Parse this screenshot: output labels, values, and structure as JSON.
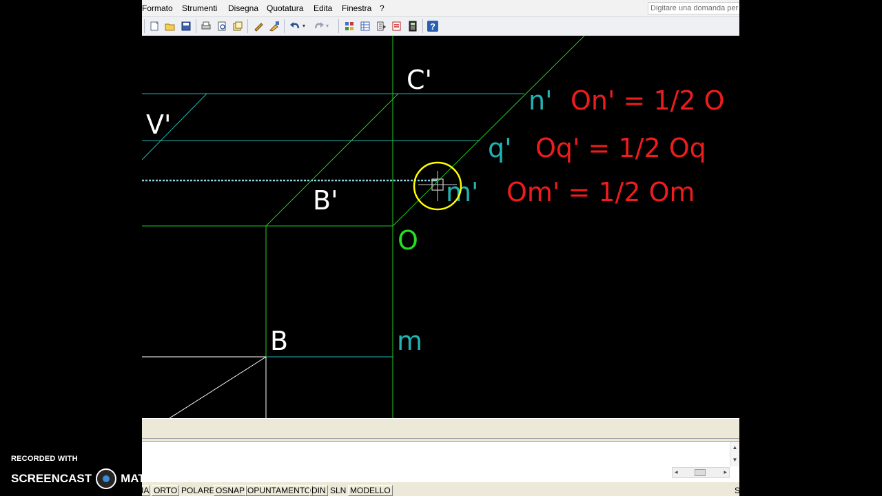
{
  "menu": [
    {
      "key": "formato",
      "label": "Formato"
    },
    {
      "key": "strumenti",
      "label": "Strumenti"
    },
    {
      "key": "disegna",
      "label": "Disegna"
    },
    {
      "key": "quotatura",
      "label": "Quotatura"
    },
    {
      "key": "edita",
      "label": "Edita"
    },
    {
      "key": "finestra",
      "label": "Finestra"
    },
    {
      "key": "help",
      "label": "?"
    }
  ],
  "help_search": {
    "placeholder": "Digitare una domanda per l'assistenza"
  },
  "toolbar": {
    "icons": [
      "new-icon",
      "open-icon",
      "save-icon",
      "plot-icon",
      "plot-preview-icon",
      "publish-icon",
      "pencil-icon",
      "match-properties-icon",
      "undo-icon",
      "undo-dropdown-icon",
      "redo-icon",
      "redo-dropdown-icon",
      "design-center-icon",
      "properties-icon",
      "tool-palette-icon",
      "markup-icon",
      "calculator-icon",
      "help-icon"
    ]
  },
  "drawing": {
    "labels": {
      "c_prime": "C'",
      "v_prime": "V'",
      "b_prime": "B'",
      "n_prime": "n'",
      "q_prime": "q'",
      "m_prime": "m'",
      "o": "O",
      "b": "B",
      "m": "m"
    },
    "formulas": {
      "n": "On' = 1/2 O",
      "q": "Oq' = 1/2 Oq",
      "m": "Om' = 1/2 Om"
    },
    "colors": {
      "white": "#ffffff",
      "cyan": "#22b3b3",
      "red": "#ee1c1c",
      "green": "#22dd22",
      "cursor": "#ffff00"
    }
  },
  "statusbar": {
    "items": [
      {
        "key": "snap",
        "label": "IA"
      },
      {
        "key": "orto",
        "label": "ORTO"
      },
      {
        "key": "polare",
        "label": "POLARE"
      },
      {
        "key": "osnap",
        "label": "OSNAP"
      },
      {
        "key": "opuntamento",
        "label": "OPUNTAMENTO"
      },
      {
        "key": "din",
        "label": "DIN"
      },
      {
        "key": "sln",
        "label": "SLN"
      },
      {
        "key": "modello",
        "label": "MODELLO"
      }
    ],
    "right_label": "S"
  },
  "watermark": {
    "line1": "RECORDED WITH",
    "line2a": "SCREENCAST",
    "line2b": "MATIC"
  }
}
